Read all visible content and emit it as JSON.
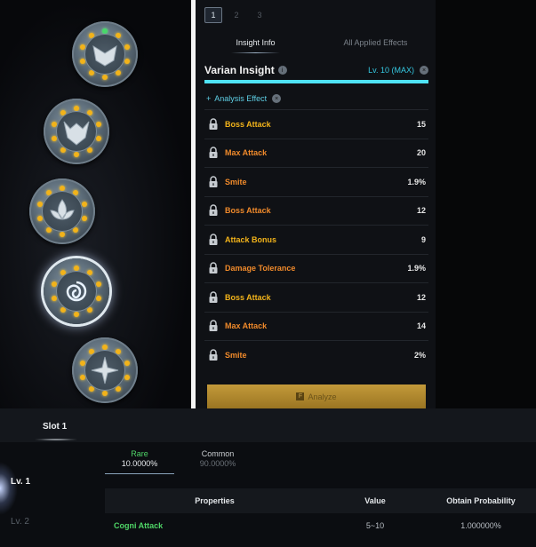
{
  "colors": {
    "gold": "#f2b31a",
    "orange": "#f08a2b",
    "cyan": "#4fe3f5",
    "rare_green": "#4fd567"
  },
  "medallions": [
    {
      "icon": "mask-crest-icon",
      "selected": false
    },
    {
      "icon": "beast-crest-icon",
      "selected": false
    },
    {
      "icon": "lotus-crest-icon",
      "selected": false
    },
    {
      "icon": "spiral-crest-icon",
      "selected": true
    },
    {
      "icon": "star-crest-icon",
      "selected": false
    }
  ],
  "page_tabs": [
    "1",
    "2",
    "3"
  ],
  "info_tabs": {
    "insight": "Insight Info",
    "applied": "All Applied Effects"
  },
  "insight": {
    "title": "Varian Insight",
    "info_glyph": "i",
    "level": "Lv. 10 (MAX)",
    "close_glyph": "×",
    "progress": 1.0
  },
  "analysis": {
    "plus": "+",
    "label": "Analysis Effect",
    "close_glyph": "×"
  },
  "effects": [
    {
      "name": "Boss Attack",
      "value": "15",
      "color": "#f2b31a"
    },
    {
      "name": "Max Attack",
      "value": "20",
      "color": "#f08a2b"
    },
    {
      "name": "Smite",
      "value": "1.9%",
      "color": "#f08a2b"
    },
    {
      "name": "Boss Attack",
      "value": "12",
      "color": "#f08a2b"
    },
    {
      "name": "Attack Bonus",
      "value": "9",
      "color": "#f2b31a"
    },
    {
      "name": "Damage Tolerance",
      "value": "1.9%",
      "color": "#f08a2b"
    },
    {
      "name": "Boss Attack",
      "value": "12",
      "color": "#f2b31a"
    },
    {
      "name": "Max Attack",
      "value": "14",
      "color": "#f08a2b"
    },
    {
      "name": "Smite",
      "value": "2%",
      "color": "#f08a2b"
    }
  ],
  "analyze": {
    "key": "F",
    "label": "Analyze"
  },
  "slot": {
    "label": "Slot 1"
  },
  "levels": [
    "Lv. 1",
    "Lv. 2"
  ],
  "rarities": [
    {
      "name": "Rare",
      "pct": "10.0000%",
      "name_color": "#4fd567",
      "pct_color": "#e9ecef"
    },
    {
      "name": "Common",
      "pct": "90.0000%",
      "name_color": "#c9cdd1",
      "pct_color": "#6b7178"
    }
  ],
  "table": {
    "headers": {
      "property": "Properties",
      "value": "Value",
      "probability": "Obtain Probability"
    },
    "rows": [
      {
        "property": "Cogni Attack",
        "value": "5~10",
        "probability": "1.000000%"
      }
    ]
  }
}
